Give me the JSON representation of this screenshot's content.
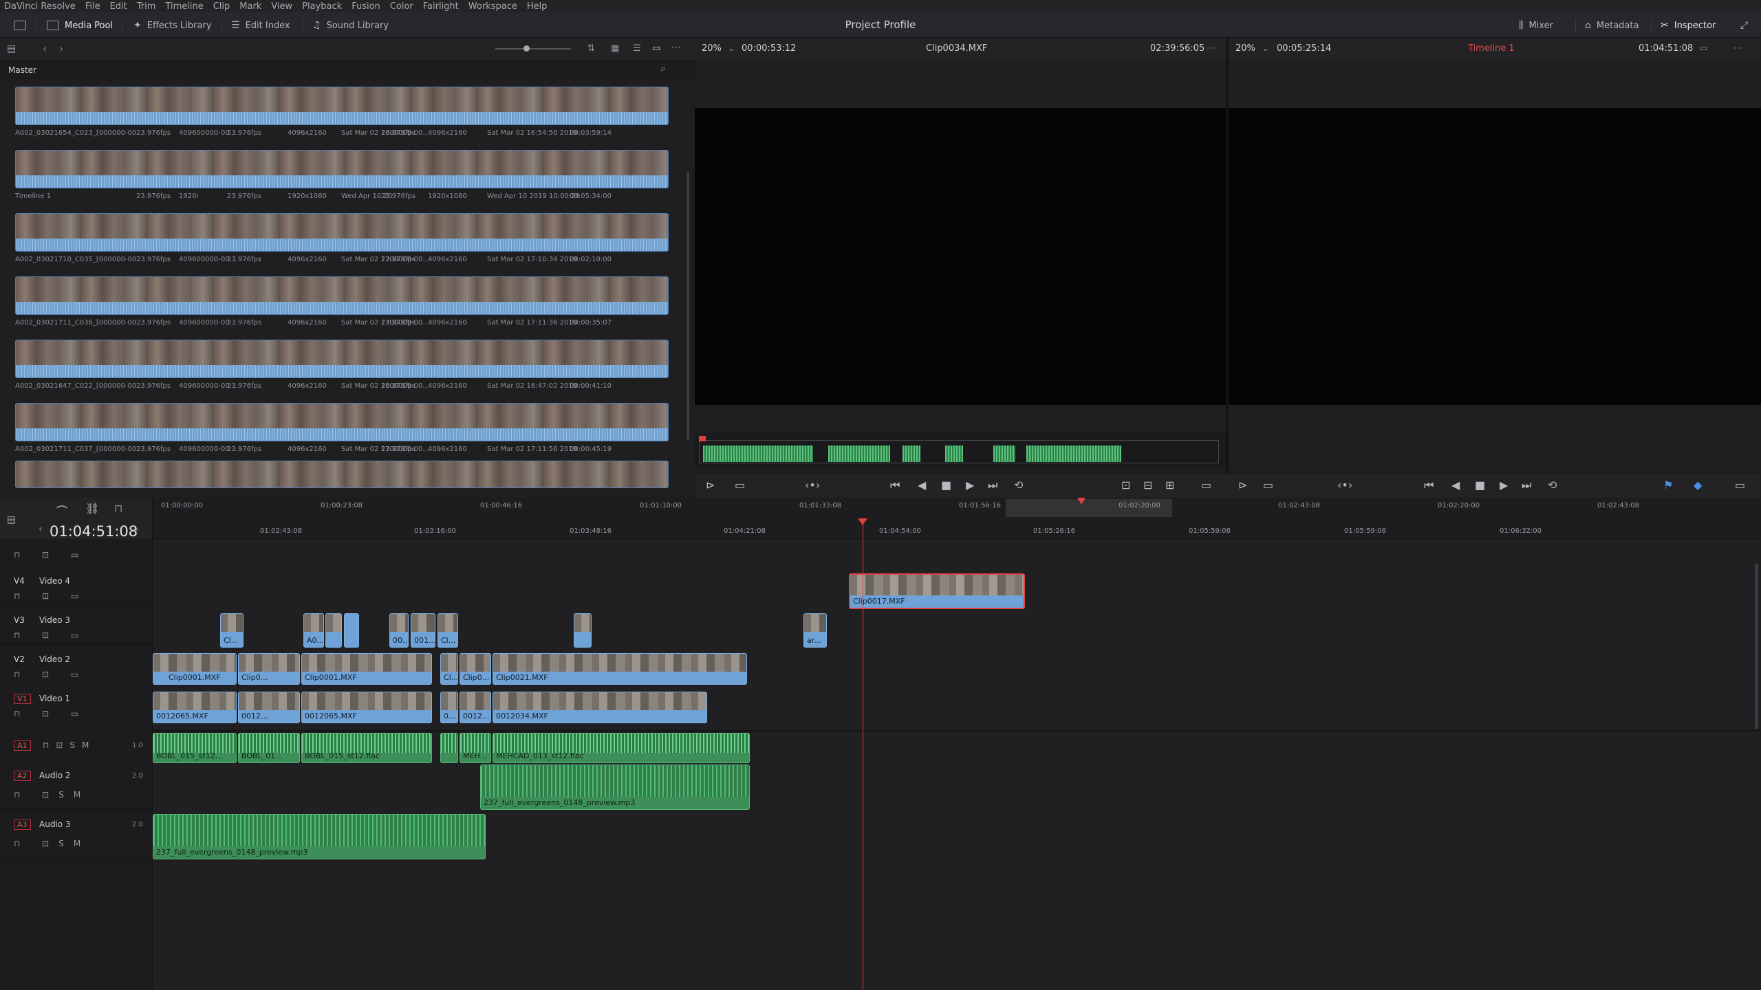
{
  "menubar": [
    "DaVinci Resolve",
    "File",
    "Edit",
    "Trim",
    "Timeline",
    "Clip",
    "Mark",
    "View",
    "Playback",
    "Fusion",
    "Color",
    "Fairlight",
    "Workspace",
    "Help"
  ],
  "toolbar": {
    "media_pool": "Media Pool",
    "effects_library": "Effects Library",
    "edit_index": "Edit Index",
    "sound_library": "Sound Library",
    "project_title": "Project Profile",
    "mixer": "Mixer",
    "metadata": "Metadata",
    "inspector": "Inspector"
  },
  "pool": {
    "bin": "Master",
    "clips": [
      {
        "name": "A002_03021654_C023_[000000-00...",
        "fps": "23.976fps",
        "code": "409600000-00...",
        "fps2": "23.976fps",
        "res": "4096x2160",
        "date": "Sat Mar 02 1600000-00...",
        "fps3": "23.976fps",
        "res2": "4096x2160",
        "date2": "Sat Mar 02 16:54:50 2019",
        "dur": "00:03:59:14"
      },
      {
        "name": "Timeline 1",
        "fps": "23.976fps",
        "code": "1920i",
        "fps2": "23.976fps",
        "res": "1920x1080",
        "date": "Wed Apr 10 20",
        "fps3": "23.976fps",
        "res2": "1920x1080",
        "date2": "Wed Apr 10 2019 10:00:29",
        "dur": "00:05:34:00"
      },
      {
        "name": "A002_03021710_C035_[000000-00...",
        "fps": "23.976fps",
        "code": "409600000-00...",
        "fps2": "23.976fps",
        "res": "4096x2160",
        "date": "Sat Mar 02 1700000-00...",
        "fps3": "23.976fps",
        "res2": "4096x2160",
        "date2": "Sat Mar 02 17:10:34 2019",
        "dur": "00:02:10:00"
      },
      {
        "name": "A002_03021711_C036_[000000-00...",
        "fps": "23.976fps",
        "code": "409600000-00...",
        "fps2": "23.976fps",
        "res": "4096x2160",
        "date": "Sat Mar 02 1700000-00...",
        "fps3": "23.976fps",
        "res2": "4096x2160",
        "date2": "Sat Mar 02 17:11:36 2019",
        "dur": "00:00:35:07"
      },
      {
        "name": "A002_03021647_C022_[000000-00...",
        "fps": "23.976fps",
        "code": "409600000-00...",
        "fps2": "23.976fps",
        "res": "4096x2160",
        "date": "Sat Mar 02 1600000-00...",
        "fps3": "23.976fps",
        "res2": "4096x2160",
        "date2": "Sat Mar 02 16:47:02 2019",
        "dur": "00:00:41:10"
      },
      {
        "name": "A002_03021711_C037_[000000-00...",
        "fps": "23.976fps",
        "code": "409600000-00...",
        "fps2": "23.976fps",
        "res": "4096x2160",
        "date": "Sat Mar 02 1700000-00...",
        "fps3": "23.976fps",
        "res2": "4096x2160",
        "date2": "Sat Mar 02 17:11:56 2019",
        "dur": "00:00:45:19"
      }
    ]
  },
  "viewer": {
    "src_zoom": "20%",
    "src_tc": "00:00:53:12",
    "src_clip": "Clip0034.MXF",
    "src_dur": "02:39:56:05",
    "rec_zoom": "20%",
    "rec_tc": "00:05:25:14",
    "timeline_name": "Timeline 1",
    "rec_dur": "01:04:51:08"
  },
  "timeline": {
    "timecode": "01:04:51:08",
    "ruler_top": [
      "01:00:00:00",
      "01:00:23:08",
      "01:00:46:16",
      "01:01:10:00",
      "01:01:33:08",
      "01:01:56:16",
      "01:02:20:00",
      "01:02:43:08",
      "01:02:20:00",
      "01:02:43:08"
    ],
    "ruler_bottom": [
      "01:02:43:08",
      "01:03:16:00",
      "01:03:48:16",
      "01:04:21:08",
      "01:04:54:00",
      "01:05:26:16",
      "01:05:59:08",
      "01:05:59:08",
      "01:06:32:00"
    ],
    "tracks": [
      {
        "id": "V4",
        "name": "Video 4"
      },
      {
        "id": "V3",
        "name": "Video 3"
      },
      {
        "id": "V2",
        "name": "Video 2"
      },
      {
        "id": "V1",
        "name": "Video 1"
      },
      {
        "id": "A1",
        "name": "",
        "level": "1.0"
      },
      {
        "id": "A2",
        "name": "Audio 2",
        "level": "2.0"
      },
      {
        "id": "A3",
        "name": "Audio 3",
        "level": "2.0"
      }
    ],
    "v4_clip": "Clip0017.MXF",
    "v2_clips": [
      "Clip0001.MXF",
      "Clip0...",
      "Clip0001.MXF",
      "Cl...",
      "Clip0...",
      "Clip0021.MXF"
    ],
    "v1_clips": [
      "0012065.MXF",
      "0012...",
      "0012065.MXF",
      "0...",
      "0012...",
      "0012034.MXF"
    ],
    "v3_clips": [
      "Cl...",
      "A0...",
      "00...",
      "001...",
      "Cl...",
      "ar..."
    ],
    "a1_clips": [
      "BOBL_015_st12...",
      "BOBL_01...",
      "BOBL_015_st12.flac",
      "MEH...",
      "MEHCAD_013_st12.flac"
    ],
    "a2_clip": "237_full_evergreens_0148_preview.mp3",
    "a3_clip": "237_full_evergreens_0148_preview.mp3"
  },
  "colors": {
    "accent": "#6fa2d6",
    "audio": "#3d8e58",
    "playhead": "#e04040"
  }
}
